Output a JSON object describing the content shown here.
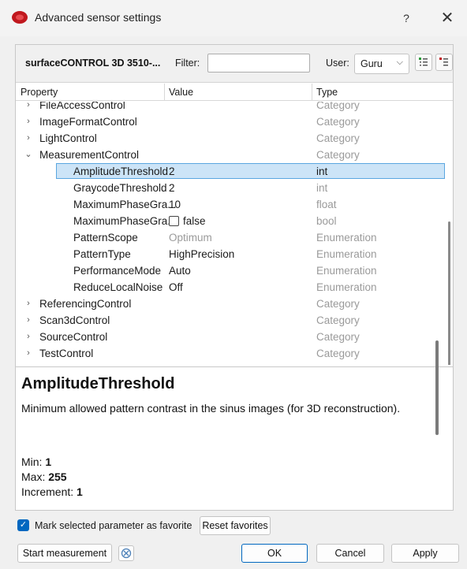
{
  "window": {
    "title": "Advanced sensor settings",
    "help_label": "?",
    "close_label": "✕"
  },
  "toolbar": {
    "device_name": "surfaceCONTROL 3D 3510-...",
    "filter_label": "Filter:",
    "filter_value": "",
    "user_label": "User:",
    "user_value": "Guru"
  },
  "grid": {
    "headers": {
      "property": "Property",
      "value": "Value",
      "type": "Type"
    },
    "rows": [
      {
        "property": "FileAccessControl",
        "value": "",
        "type": "Category",
        "expander": "›",
        "value_gray": false
      },
      {
        "property": "ImageFormatControl",
        "value": "",
        "type": "Category",
        "expander": "›",
        "value_gray": false
      },
      {
        "property": "LightControl",
        "value": "",
        "type": "Category",
        "expander": "›",
        "value_gray": false
      },
      {
        "property": "MeasurementControl",
        "value": "",
        "type": "Category",
        "expander": "⌄",
        "value_gray": false
      },
      {
        "property": "AmplitudeThreshold",
        "value": "2",
        "type": "int",
        "expander": "",
        "value_gray": false,
        "selected": true
      },
      {
        "property": "GraycodeThreshold",
        "value": "2",
        "type": "int",
        "expander": "",
        "value_gray": false
      },
      {
        "property": "MaximumPhaseGra...",
        "value": "10",
        "type": "float",
        "expander": "",
        "value_gray": false
      },
      {
        "property": "MaximumPhaseGra...",
        "value": "false",
        "type": "bool",
        "expander": "",
        "value_gray": false,
        "checkbox": true
      },
      {
        "property": "PatternScope",
        "value": "Optimum",
        "type": "Enumeration",
        "expander": "",
        "value_gray": true
      },
      {
        "property": "PatternType",
        "value": "HighPrecision",
        "type": "Enumeration",
        "expander": "",
        "value_gray": false
      },
      {
        "property": "PerformanceMode",
        "value": "Auto",
        "type": "Enumeration",
        "expander": "",
        "value_gray": false
      },
      {
        "property": "ReduceLocalNoise",
        "value": "Off",
        "type": "Enumeration",
        "expander": "",
        "value_gray": false
      },
      {
        "property": "ReferencingControl",
        "value": "",
        "type": "Category",
        "expander": "›",
        "value_gray": false
      },
      {
        "property": "Scan3dControl",
        "value": "",
        "type": "Category",
        "expander": "›",
        "value_gray": false
      },
      {
        "property": "SourceControl",
        "value": "",
        "type": "Category",
        "expander": "›",
        "value_gray": false
      },
      {
        "property": "TestControl",
        "value": "",
        "type": "Category",
        "expander": "›",
        "value_gray": false
      }
    ]
  },
  "description": {
    "title": "AmplitudeThreshold",
    "text": "Minimum allowed pattern contrast in the sinus images (for 3D reconstruction).",
    "min_label": "Min:",
    "min_value": "1",
    "max_label": "Max:",
    "max_value": "255",
    "increment_label": "Increment:",
    "increment_value": "1"
  },
  "footer": {
    "favorite_checked": true,
    "favorite_label": "Mark selected parameter as favorite",
    "reset_favorites": "Reset favorites",
    "start_measurement": "Start measurement",
    "ok": "OK",
    "cancel": "Cancel",
    "apply": "Apply"
  },
  "colors": {
    "accent": "#0067c0",
    "selection": "#cce4f7",
    "app_icon": "#c0181e"
  },
  "icons": {
    "app": "sensor-logo-icon",
    "expand_all": "expand-tree-icon",
    "collapse_all": "collapse-tree-icon",
    "measurement": "measurement-status-icon"
  }
}
